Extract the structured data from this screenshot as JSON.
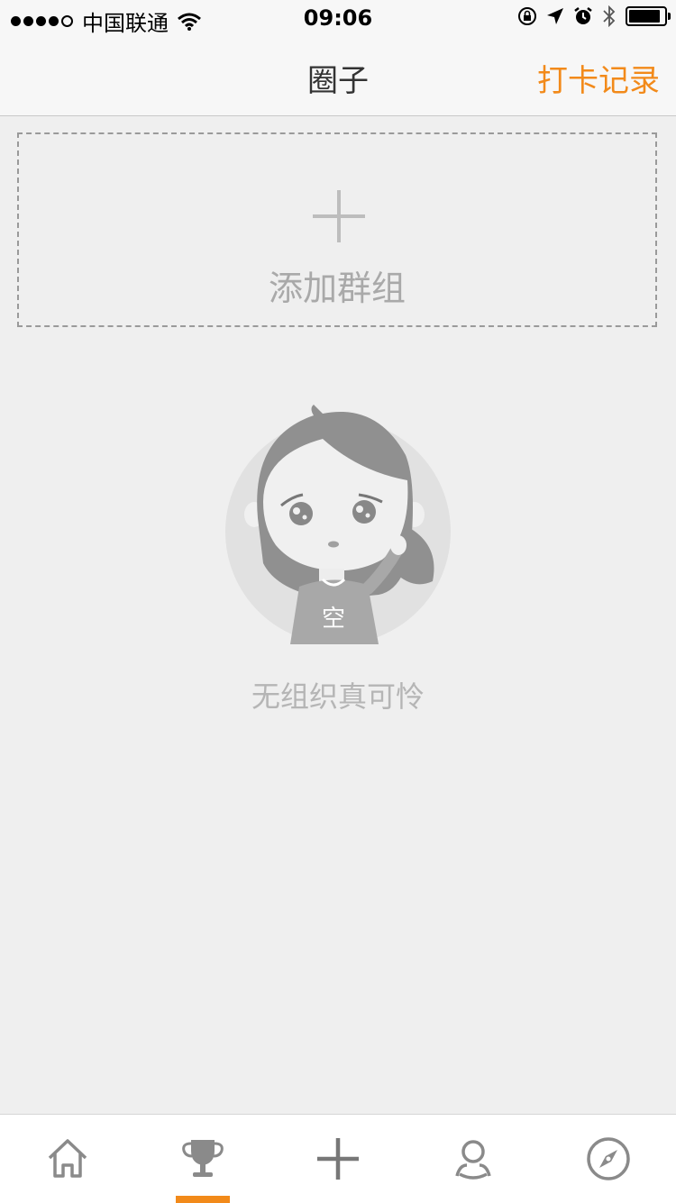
{
  "status_bar": {
    "carrier": "中国联通",
    "time": "09:06"
  },
  "nav": {
    "title": "圈子",
    "right_action": "打卡记录"
  },
  "add_group": {
    "label": "添加群组"
  },
  "empty_state": {
    "shirt_text": "空",
    "message": "无组织真可怜"
  },
  "tab_bar": {
    "items": [
      {
        "icon": "home-icon"
      },
      {
        "icon": "trophy-icon",
        "selected": true
      },
      {
        "icon": "plus-icon"
      },
      {
        "icon": "user-icon"
      },
      {
        "icon": "compass-icon"
      }
    ]
  },
  "colors": {
    "accent": "#f28a1a",
    "background": "#efefef",
    "placeholder_text": "#a9a9a9"
  }
}
